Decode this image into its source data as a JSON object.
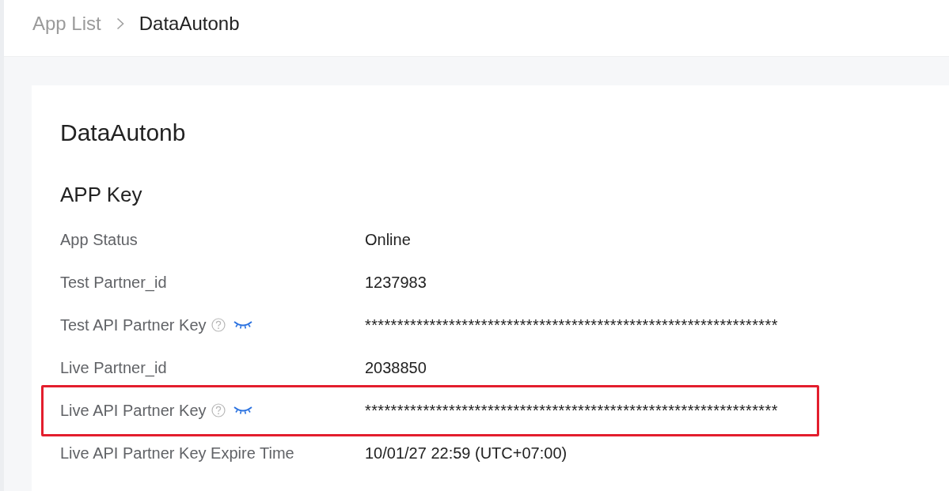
{
  "breadcrumb": [
    {
      "label": "App List",
      "current": false
    },
    {
      "label": "DataAutonb",
      "current": true
    }
  ],
  "card": {
    "title": "DataAutonb",
    "section_title": "APP Key",
    "fields": [
      {
        "kind": "plain",
        "label": "App Status",
        "value": "Online",
        "highlighted": false
      },
      {
        "kind": "plain",
        "label": "Test Partner_id",
        "value": "1237983",
        "highlighted": false
      },
      {
        "kind": "secret",
        "label": "Test API Partner Key",
        "value": "****************************************************************",
        "revealed": false,
        "highlighted": false
      },
      {
        "kind": "plain",
        "label": "Live Partner_id",
        "value": "2038850",
        "highlighted": false
      },
      {
        "kind": "secret",
        "label": "Live API Partner Key",
        "value": "****************************************************************",
        "revealed": false,
        "highlighted": true
      },
      {
        "kind": "plain",
        "label": "Live API Partner Key Expire Time",
        "value": "10/01/27 22:59 (UTC+07:00)",
        "highlighted": false
      }
    ]
  }
}
